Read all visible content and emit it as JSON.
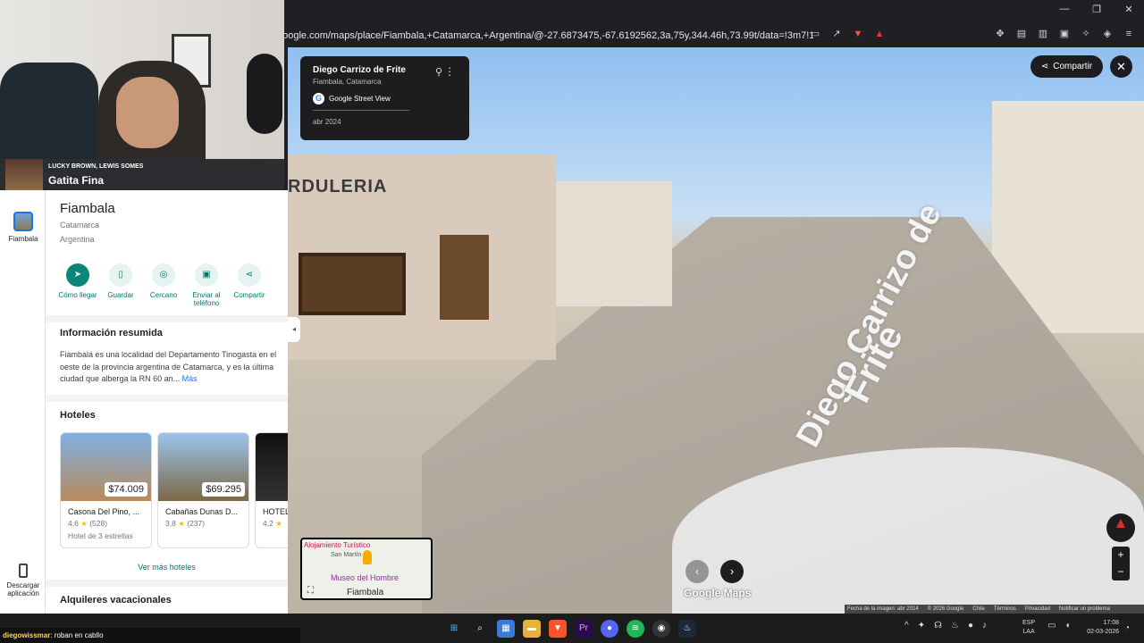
{
  "browser": {
    "url": "google.com/maps/place/Fiambala,+Catamarca,+Argentina/@-27.6873475,-67.6192562,3a,75y,344.46h,73.99t/data=!3m7!1e1!3m5!1sL3XTN1R...",
    "window_controls": [
      "—",
      "❐",
      "✕"
    ],
    "toolbar_icons": [
      "cast-icon",
      "share-icon",
      "brave-shield-icon",
      "rewards-icon"
    ],
    "ext_icons": [
      "puzzle-icon",
      "tab-icon",
      "sidebar-icon",
      "wallet-icon",
      "leo-icon",
      "vpn-icon",
      "menu-icon"
    ]
  },
  "webcam": {
    "music_artist": "LUCKY BROWN, LEWIS SOMES",
    "music_song": "Gatita Fina"
  },
  "street_view": {
    "location_title": "Diego Carrizo de Frite",
    "location_sub": "Fiambala, Catamarca",
    "source_label": "Google Street View",
    "capture_date": "abr 2024",
    "share_label": "Compartir",
    "close_glyph": "✕",
    "sign_text": "RDULERIA",
    "road_text_1": "Diego Carrizo de",
    "road_text_2": "Frite",
    "logo": "Google Maps",
    "nav_prev": "‹",
    "nav_next": "›",
    "zoom_in": "+",
    "zoom_out": "−",
    "minimap": {
      "label_poi1": "Alojamiento Turístico",
      "label_street": "San Martín",
      "label_poi2": "Museo del Hombre",
      "label_town": "Fiambala"
    },
    "footer": [
      "Fecha de la imagen: abr 2024",
      "© 2026 Google",
      "Chile",
      "Términos",
      "Privacidad",
      "Notificar un problema"
    ]
  },
  "rail": {
    "place_label": "Fiambala",
    "download_label": "Descargar aplicación"
  },
  "panel": {
    "title": "Fiambala",
    "sub1": "Catamarca",
    "sub2": "Argentina",
    "actions": [
      {
        "label": "Cómo llegar",
        "glyph": "➤"
      },
      {
        "label": "Guardar",
        "glyph": "▯"
      },
      {
        "label": "Cercano",
        "glyph": "◎"
      },
      {
        "label": "Enviar al teléfono",
        "glyph": "▣"
      },
      {
        "label": "Compartir",
        "glyph": "⋖"
      }
    ],
    "summary_title": "Información resumida",
    "summary_text": "Fiambalá es una localidad del Departamento Tinogasta en el oeste de la provincia argentina de Catamarca, y es la última ciudad que alberga la RN 60 an...",
    "summary_more": "Más",
    "hotels_title": "Hoteles",
    "hotels": [
      {
        "name": "Casona Del Pino, ...",
        "price": "$74.009",
        "rating": "4,6",
        "reviews": "(528)",
        "type": "Hotel de 3 estrellas"
      },
      {
        "name": "Cabañas Dunas D...",
        "price": "$69.295",
        "rating": "3,8",
        "reviews": "(237)",
        "type": ""
      },
      {
        "name": "HOTEL",
        "price": "",
        "rating": "4,2",
        "reviews": "",
        "type": ""
      }
    ],
    "see_more_hotels": "Ver más hoteles",
    "rentals_title": "Alquileres vacacionales"
  },
  "chat": {
    "user": "diegowissmar",
    "message": ": roban en cabllo"
  },
  "taskbar": {
    "lang_1": "ESP",
    "lang_2": "LAA",
    "time": "17:08",
    "date": "02-03-2026"
  }
}
